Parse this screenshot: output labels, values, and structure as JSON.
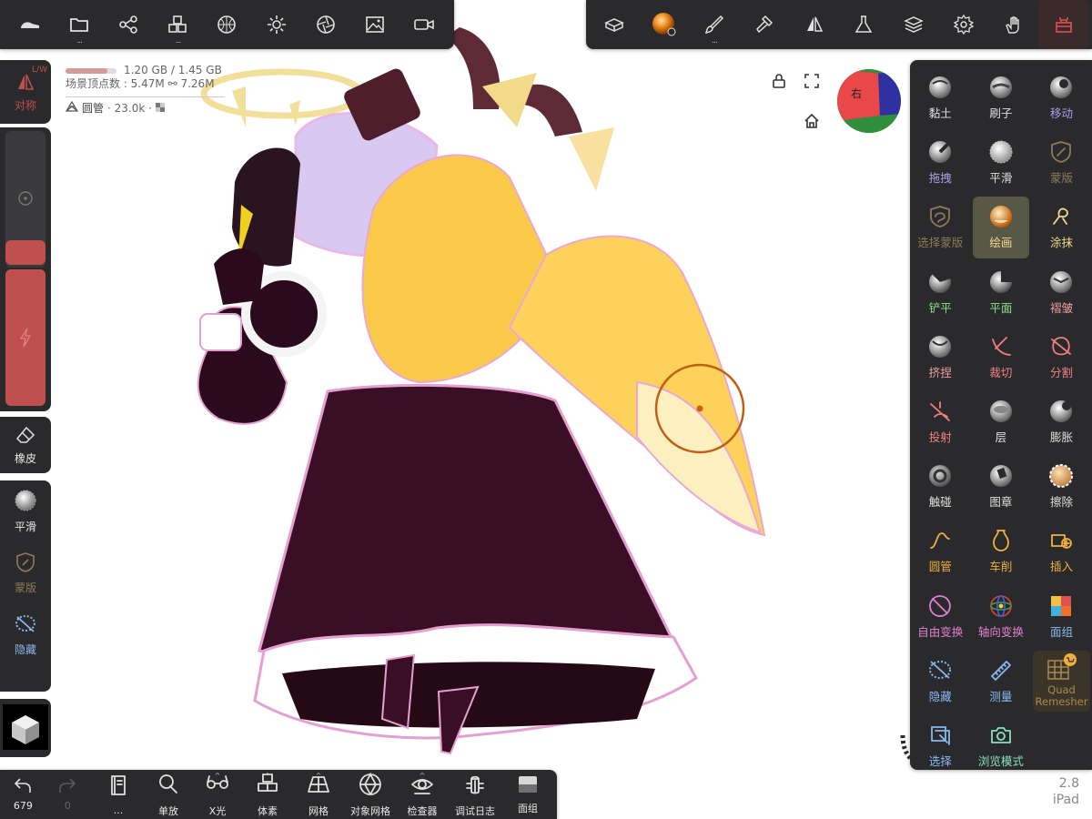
{
  "colors": {
    "panel_bg": "#2a2a2c",
    "accent_red": "#c05050",
    "active_tool_bg": "#585846",
    "brush_cursor": "#c06010"
  },
  "top_left_toolbar": {
    "items": [
      {
        "icon": "shoe-icon"
      },
      {
        "icon": "folder-icon",
        "more": "..."
      },
      {
        "icon": "share-nodes-icon"
      },
      {
        "icon": "cubes-icon",
        "more": "..."
      },
      {
        "icon": "sphere-grid-icon"
      },
      {
        "icon": "sun-icon"
      },
      {
        "icon": "aperture-icon"
      },
      {
        "icon": "image-icon"
      },
      {
        "icon": "video-icon"
      }
    ]
  },
  "top_right_toolbar": {
    "items": [
      {
        "icon": "box-stack-icon"
      },
      {
        "icon": "material-ball-icon"
      },
      {
        "icon": "brush-icon",
        "more": "..."
      },
      {
        "icon": "hammer-icon"
      },
      {
        "icon": "symmetry-icon"
      },
      {
        "icon": "flask-icon"
      },
      {
        "icon": "layers-icon"
      },
      {
        "icon": "gear-icon"
      },
      {
        "icon": "gesture-hand-icon"
      },
      {
        "icon": "toolbox-icon"
      }
    ]
  },
  "info": {
    "memory": "1.20 GB / 1.45 GB",
    "memory_ratio": 0.83,
    "vertices_label": "场景顶点数 : 5.47M",
    "vertices_link": "7.26M",
    "tool_name": "圆管",
    "tool_count": "· 23.0k ·"
  },
  "left_panel": {
    "symmetry": {
      "badge": "L/W",
      "label": "对称"
    },
    "slider_top": {
      "value": 0.0
    },
    "slider_bottom": {
      "value": 1.0
    },
    "eraser": {
      "label": "橡皮"
    },
    "quick_tools": [
      {
        "label": "平滑",
        "icon": "smooth-sphere-icon"
      },
      {
        "label": "蒙版",
        "icon": "mask-shield-icon"
      },
      {
        "label": "隐藏",
        "icon": "hide-lasso-icon"
      }
    ]
  },
  "tools": [
    {
      "label": "黏土",
      "color": "#e0e0e0",
      "icon": "clay-sphere-icon"
    },
    {
      "label": "刷子",
      "color": "#e0e0e0",
      "icon": "brush-sphere-icon"
    },
    {
      "label": "移动",
      "color": "#a8a0e8",
      "icon": "move-sphere-icon"
    },
    {
      "label": "拖拽",
      "color": "#a8a0e8",
      "icon": "drag-sphere-icon"
    },
    {
      "label": "平滑",
      "color": "#e0e0e0",
      "icon": "smooth-sphere-icon"
    },
    {
      "label": "蒙版",
      "color": "#8c7a5a",
      "icon": "mask-shield-icon"
    },
    {
      "label": "选择蒙版",
      "color": "#8c7a5a",
      "icon": "select-mask-icon"
    },
    {
      "label": "绘画",
      "color": "#f0d890",
      "icon": "paint-sphere-icon",
      "active": true
    },
    {
      "label": "涂抹",
      "color": "#f0d890",
      "icon": "smudge-icon"
    },
    {
      "label": "铲平",
      "color": "#90e090",
      "icon": "flatten-sphere-icon"
    },
    {
      "label": "平面",
      "color": "#90e090",
      "icon": "planar-sphere-icon"
    },
    {
      "label": "褶皱",
      "color": "#f0a0a0",
      "icon": "crease-sphere-icon"
    },
    {
      "label": "挤捏",
      "color": "#f0a0a0",
      "icon": "pinch-sphere-icon"
    },
    {
      "label": "裁切",
      "color": "#f08080",
      "icon": "trim-icon"
    },
    {
      "label": "分割",
      "color": "#f08080",
      "icon": "split-icon"
    },
    {
      "label": "投射",
      "color": "#f08080",
      "icon": "project-icon"
    },
    {
      "label": "层",
      "color": "#e0e0e0",
      "icon": "layer-sphere-icon"
    },
    {
      "label": "膨胀",
      "color": "#e0e0e0",
      "icon": "inflate-sphere-icon"
    },
    {
      "label": "触碰",
      "color": "#e0e0e0",
      "icon": "tube-sphere-icon"
    },
    {
      "label": "图章",
      "color": "#e0e0e0",
      "icon": "stamp-sphere-icon"
    },
    {
      "label": "擦除",
      "color": "#e0e0e0",
      "icon": "erase-sphere-icon"
    },
    {
      "label": "圆管",
      "color": "#f0b040",
      "icon": "tube-curve-icon"
    },
    {
      "label": "车削",
      "color": "#f0b040",
      "icon": "lathe-vase-icon"
    },
    {
      "label": "插入",
      "color": "#f0b040",
      "icon": "insert-plus-icon"
    },
    {
      "label": "自由变换",
      "color": "#e080d0",
      "icon": "free-transform-icon"
    },
    {
      "label": "轴向变换",
      "color": "#e080d0",
      "icon": "gizmo-icon"
    },
    {
      "label": "面组",
      "color": "#88b8f0",
      "icon": "face-group-icon"
    },
    {
      "label": "隐藏",
      "color": "#88b8f0",
      "icon": "hide-lasso-icon"
    },
    {
      "label": "测量",
      "color": "#88b8f0",
      "icon": "ruler-icon"
    },
    {
      "label": "Quad Remesher",
      "color": "#a88a50",
      "icon": "quad-remesher-icon"
    },
    {
      "label": "选择",
      "color": "#88b8f0",
      "icon": "select-box-icon"
    },
    {
      "label": "浏览模式",
      "color": "#88e0c0",
      "icon": "camera-icon"
    }
  ],
  "gizmo_cube": {
    "face_label": "右"
  },
  "bottom_toolbar": {
    "undo_count": "679",
    "redo_count": "0",
    "items": [
      {
        "label": "...",
        "icon": "book-icon"
      },
      {
        "label": "单放",
        "icon": "magnify-icon"
      },
      {
        "label": "X光",
        "icon": "glasses-icon"
      },
      {
        "label": "体素",
        "icon": "voxel-icon"
      },
      {
        "label": "网格",
        "icon": "grid-plane-icon"
      },
      {
        "label": "对象网格",
        "icon": "wire-sphere-icon"
      },
      {
        "label": "检查器",
        "icon": "eye-inspect-icon"
      },
      {
        "label": "调试日志",
        "icon": "bug-icon"
      },
      {
        "label": "面组",
        "icon": "face-group-icon"
      }
    ]
  },
  "version": {
    "number": "2.8",
    "device": "iPad"
  }
}
